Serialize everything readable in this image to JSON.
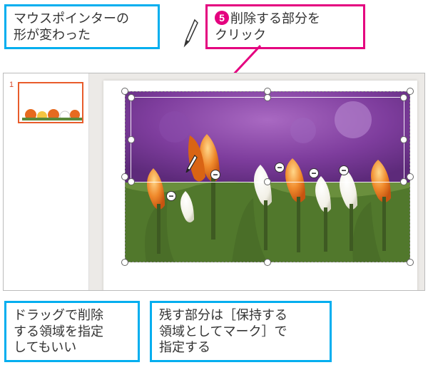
{
  "callouts": {
    "topLeft": "マウスポインターの\n形が変わった",
    "topRight": {
      "step": "5",
      "text": "削除する部分を\nクリック"
    },
    "bottomLeft": "ドラッグで削除\nする領域を指定\nしてもいい",
    "bottomRight": "残す部分は［保持する\n領域としてマーク］で\n指定する"
  },
  "editor": {
    "slideNumber": "1"
  }
}
